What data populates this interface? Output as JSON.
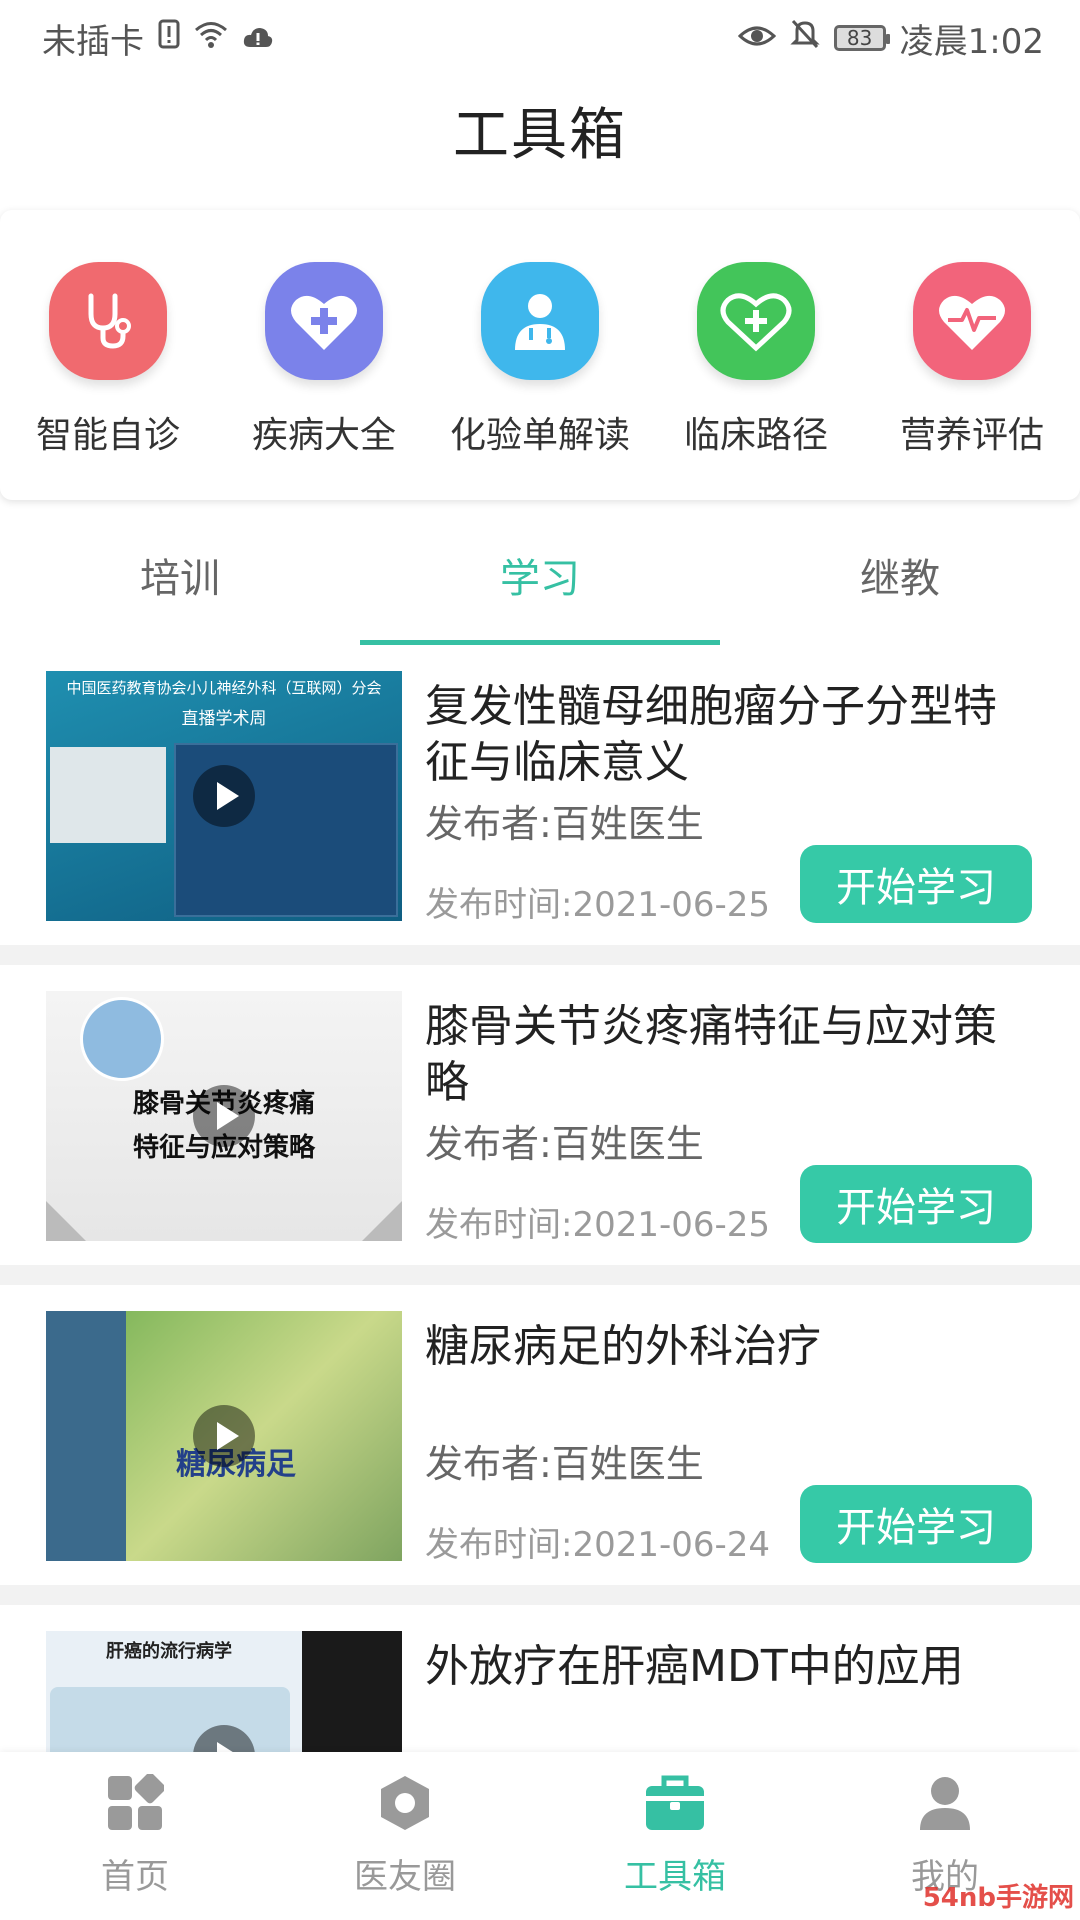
{
  "status_bar": {
    "carrier": "未插卡",
    "battery": "83",
    "time": "凌晨1:02"
  },
  "header": {
    "title": "工具箱"
  },
  "tools": [
    {
      "label": "智能自诊",
      "icon": "stethoscope-icon",
      "color": "#f06a6f"
    },
    {
      "label": "疾病大全",
      "icon": "heart-plus-icon",
      "color": "#7b82ea"
    },
    {
      "label": "化验单解读",
      "icon": "doctor-icon",
      "color": "#3fb7ec"
    },
    {
      "label": "临床路径",
      "icon": "heart-plus-icon",
      "color": "#43c55a"
    },
    {
      "label": "营养评估",
      "icon": "heart-pulse-icon",
      "color": "#f2647b"
    }
  ],
  "tabs": [
    {
      "label": "培训",
      "active": false
    },
    {
      "label": "学习",
      "active": true
    },
    {
      "label": "继教",
      "active": false
    }
  ],
  "courses": [
    {
      "title": "复发性髓母细胞瘤分子分型特征与临床意义",
      "publisher": "发布者:百姓医生",
      "time": "发布时间:2021-06-25",
      "button": "开始学习",
      "thumb_lines": [
        "中国医药教育协会小儿神经外科（互联网）分会",
        "直播学术周"
      ]
    },
    {
      "title": "膝骨关节炎疼痛特征与应对策略",
      "publisher": "发布者:百姓医生",
      "time": "发布时间:2021-06-25",
      "button": "开始学习",
      "thumb_lines": [
        "膝骨关节炎疼痛",
        "特征与应对策略"
      ]
    },
    {
      "title": "糖尿病足的外科治疗",
      "publisher": "发布者:百姓医生",
      "time": "发布时间:2021-06-24",
      "button": "开始学习",
      "thumb_lines": [
        "糖尿病足"
      ]
    },
    {
      "title": "外放疗在肝癌MDT中的应用",
      "publisher": "",
      "time": "",
      "button": "",
      "thumb_lines": [
        "肝癌的流行病学"
      ]
    }
  ],
  "bottom_nav": [
    {
      "label": "首页",
      "icon": "home-grid-icon",
      "active": false
    },
    {
      "label": "医友圈",
      "icon": "hexagon-icon",
      "active": false
    },
    {
      "label": "工具箱",
      "icon": "toolbox-icon",
      "active": true
    },
    {
      "label": "我的",
      "icon": "person-icon",
      "active": false
    }
  ],
  "watermark": "54nb手游网",
  "colors": {
    "accent": "#36c0a3",
    "button": "#36c9a7"
  }
}
